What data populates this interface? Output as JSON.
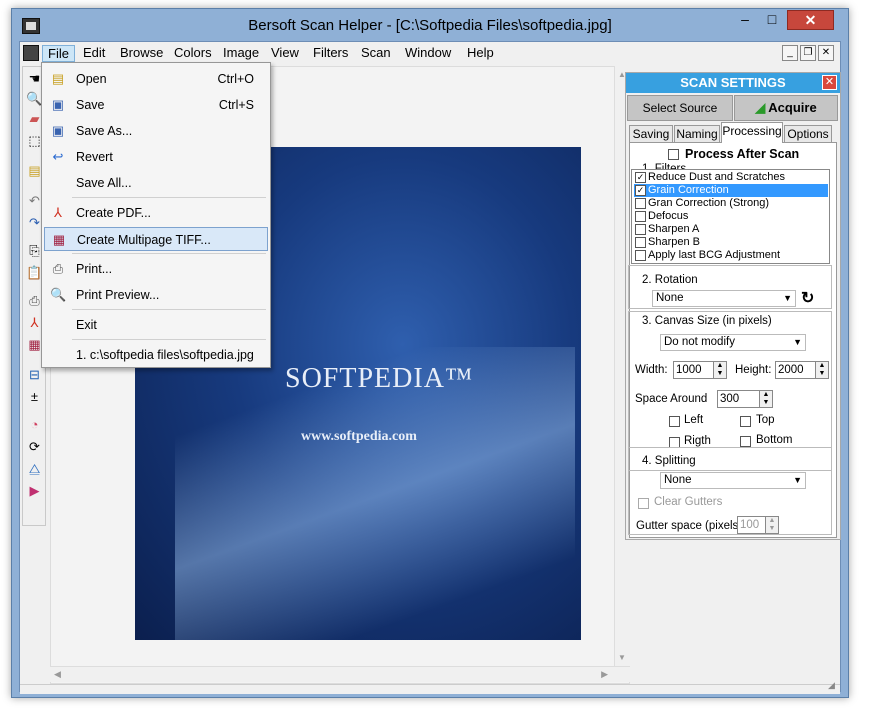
{
  "window": {
    "title": "Bersoft Scan Helper - [C:\\Softpedia Files\\softpedia.jpg]",
    "min": "–",
    "max": "□",
    "close": "✕"
  },
  "menubar": {
    "items": [
      "File",
      "Edit",
      "Browse",
      "Colors",
      "Image",
      "View",
      "Filters",
      "Scan",
      "Window",
      "Help"
    ],
    "mdi_min": "_",
    "mdi_restore": "❐",
    "mdi_close": "✕"
  },
  "file_menu": {
    "items": [
      {
        "label": "Open",
        "shortcut": "Ctrl+O",
        "icon": "open-folder-icon"
      },
      {
        "label": "Save",
        "shortcut": "Ctrl+S",
        "icon": "save-disk-icon"
      },
      {
        "label": "Save As...",
        "shortcut": "",
        "icon": "save-as-icon"
      },
      {
        "label": "Revert",
        "shortcut": "",
        "icon": "revert-arrow-icon"
      },
      {
        "label": "Save All...",
        "shortcut": "",
        "icon": ""
      },
      {
        "label": "Create PDF...",
        "shortcut": "",
        "icon": "pdf-icon"
      },
      {
        "label": "Create Multipage TIFF...",
        "shortcut": "",
        "icon": "tiff-icon"
      },
      {
        "label": "Print...",
        "shortcut": "",
        "icon": "printer-icon"
      },
      {
        "label": "Print Preview...",
        "shortcut": "",
        "icon": "print-preview-icon"
      },
      {
        "label": "Exit",
        "shortcut": "",
        "icon": ""
      },
      {
        "label": "1. c:\\softpedia files\\softpedia.jpg",
        "shortcut": "",
        "icon": ""
      }
    ]
  },
  "image": {
    "brand": "SOFTPEDIA™",
    "url": "www.softpedia.com"
  },
  "scan_settings": {
    "title": "SCAN SETTINGS",
    "close": "✕",
    "select_source": "Select Source",
    "acquire": "Acquire",
    "tabs": [
      "Saving",
      "Naming",
      "Processing",
      "Options"
    ],
    "active_tab": "Processing",
    "process_after_scan": "Process After Scan",
    "filters_label": "1. Filters",
    "filters": [
      {
        "label": "Reduce Dust and Scratches",
        "checked": true,
        "selected": false
      },
      {
        "label": "Grain Correction",
        "checked": true,
        "selected": true
      },
      {
        "label": "Gran Correction (Strong)",
        "checked": false,
        "selected": false
      },
      {
        "label": "Defocus",
        "checked": false,
        "selected": false
      },
      {
        "label": "Sharpen A",
        "checked": false,
        "selected": false
      },
      {
        "label": "Sharpen B",
        "checked": false,
        "selected": false
      },
      {
        "label": "Apply last BCG Adjustment",
        "checked": false,
        "selected": false
      }
    ],
    "rotation_label": "2. Rotation",
    "rotation_value": "None",
    "canvas_label": "3. Canvas Size (in pixels)",
    "canvas_mode": "Do not modify",
    "width_label": "Width:",
    "width_value": "1000",
    "height_label": "Height:",
    "height_value": "2000",
    "space_label": "Space Around",
    "space_value": "300",
    "left_label": "Left",
    "top_label": "Top",
    "right_label": "Rigth",
    "bottom_label": "Bottom",
    "splitting_label": "4. Splitting",
    "splitting_value": "None",
    "clear_gutters": "Clear Gutters",
    "gutter_label": "Gutter space (pixels)",
    "gutter_value": "100"
  }
}
